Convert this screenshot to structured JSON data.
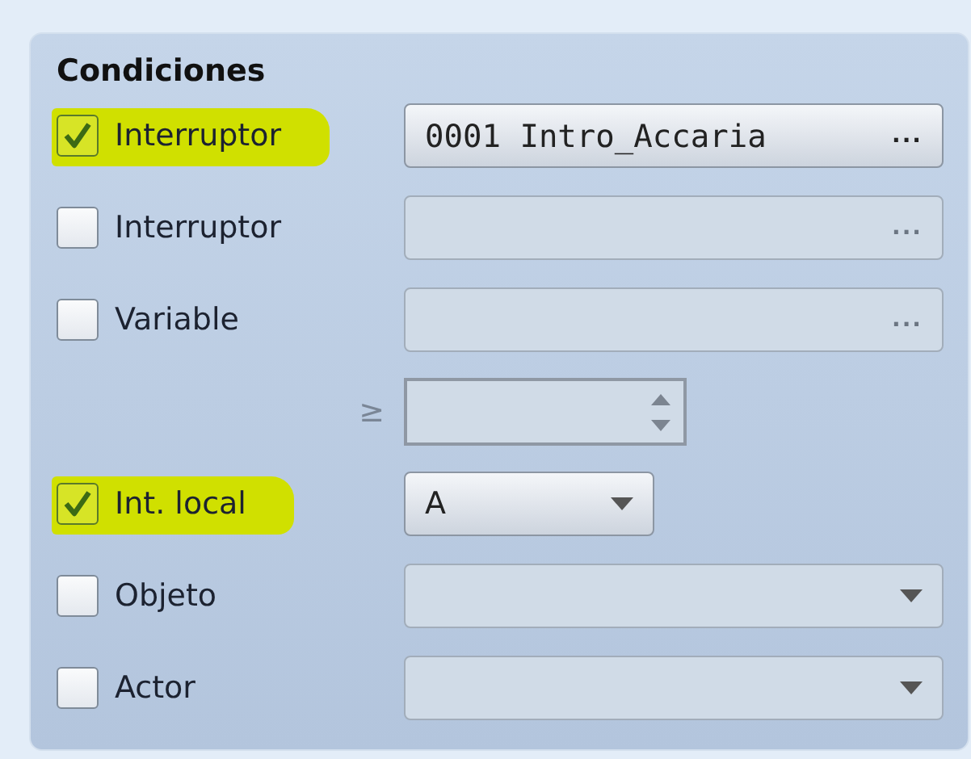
{
  "panel": {
    "title": "Condiciones"
  },
  "rows": [
    {
      "kind": "checkbox",
      "label": "Interruptor",
      "checked": true,
      "highlighted": true,
      "control": {
        "kind": "picker",
        "value": "0001 Intro_Accaria",
        "button": "...",
        "disabled": false
      }
    },
    {
      "kind": "checkbox",
      "label": "Interruptor",
      "checked": false,
      "highlighted": false,
      "control": {
        "kind": "picker",
        "button": "...",
        "disabled": true
      }
    },
    {
      "kind": "checkbox",
      "label": "Variable",
      "checked": false,
      "highlighted": false,
      "control": {
        "kind": "picker",
        "button": "...",
        "disabled": true
      }
    },
    {
      "kind": "compare",
      "symbol": "≥",
      "control": {
        "kind": "spinner",
        "disabled": true
      }
    },
    {
      "kind": "checkbox",
      "label": "Int. local",
      "checked": true,
      "highlighted": true,
      "control": {
        "kind": "short-select",
        "value": "A",
        "disabled": false
      }
    },
    {
      "kind": "checkbox",
      "label": "Objeto",
      "checked": false,
      "highlighted": false,
      "control": {
        "kind": "select",
        "disabled": true
      }
    },
    {
      "kind": "checkbox",
      "label": "Actor",
      "checked": false,
      "highlighted": false,
      "control": {
        "kind": "select",
        "disabled": true
      }
    }
  ]
}
